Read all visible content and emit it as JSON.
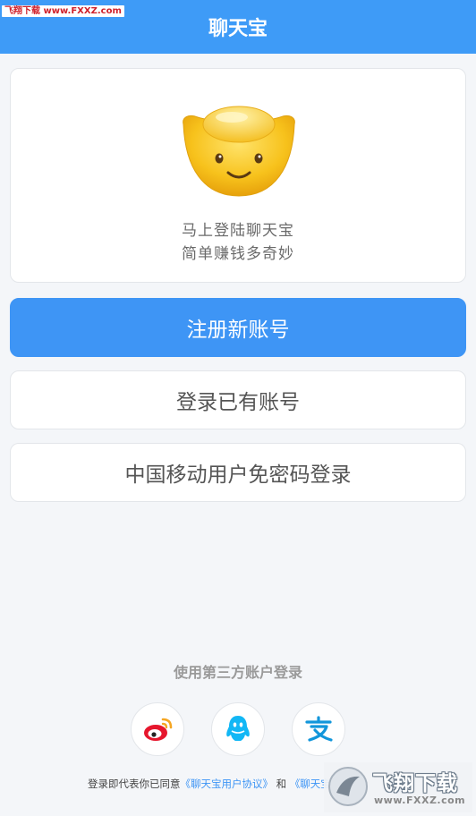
{
  "header": {
    "title": "聊天宝"
  },
  "watermark_top": "飞翔下载 www.FXXZ.com",
  "card": {
    "mascot_icon": "gold-ingot-smiley-icon",
    "tagline_1": "马上登陆聊天宝",
    "tagline_2": "简单赚钱多奇妙"
  },
  "buttons": {
    "register": "注册新账号",
    "login": "登录已有账号",
    "mobile_login": "中国移动用户免密码登录"
  },
  "third_party": {
    "title": "使用第三方账户登录",
    "icons": [
      "weibo-icon",
      "qq-icon",
      "alipay-icon"
    ]
  },
  "agreement": {
    "prefix": "登录即代表你已同意",
    "link1": "《聊天宝用户协议》",
    "and": "和",
    "link2": "《聊天宝"
  },
  "watermark_logo": {
    "name": "飞翔下载",
    "url": "www.FXXZ.com"
  },
  "colors": {
    "header": "#3e9bf7",
    "primary_button": "#3e95f5",
    "background": "#f4f6f9",
    "link": "#3e95f5"
  }
}
